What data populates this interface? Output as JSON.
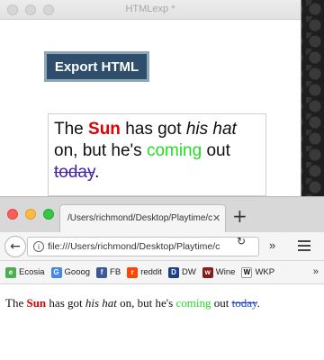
{
  "app": {
    "title": "HTMLexp *",
    "export_label": "Export HTML",
    "preview": {
      "part1": "The ",
      "sun": "Sun",
      "part2": " has got ",
      "hat": "his hat",
      "part3": " on, but he's ",
      "coming": "coming",
      "part4": " out ",
      "today": "today",
      "part5": "."
    }
  },
  "browser": {
    "tab_title": "/Users/richmond/Desktop/Playtime/c",
    "url": "file:///Users/richmond/Desktop/Playtime/c",
    "bookmarks": [
      {
        "label": "Ecosia",
        "icon": "ecosia-icon",
        "color": "#4caf50",
        "glyph": "e"
      },
      {
        "label": "Gooog",
        "icon": "google-icon",
        "color": "#4285f4",
        "glyph": "G"
      },
      {
        "label": "FB",
        "icon": "facebook-icon",
        "color": "#3b5998",
        "glyph": "f"
      },
      {
        "label": "reddit",
        "icon": "reddit-icon",
        "color": "#ff4500",
        "glyph": "r"
      },
      {
        "label": "DW",
        "icon": "dw-icon",
        "color": "#1b3f8b",
        "glyph": "D"
      },
      {
        "label": "Wine",
        "icon": "wine-icon",
        "color": "#8b1a1a",
        "glyph": "w"
      },
      {
        "label": "WKP",
        "icon": "wikipedia-icon",
        "color": "#ffffff",
        "glyph": "W"
      }
    ],
    "page": {
      "part1": "The ",
      "sun": "Sun",
      "part2": " has got ",
      "hat": "his hat",
      "part3": " on, but he's ",
      "coming": "coming",
      "part4": " out ",
      "today": "today",
      "part5": "."
    }
  },
  "colors": {
    "sun": "#e00000",
    "coming": "#22dd22",
    "export_button": "#2f4e6b"
  }
}
